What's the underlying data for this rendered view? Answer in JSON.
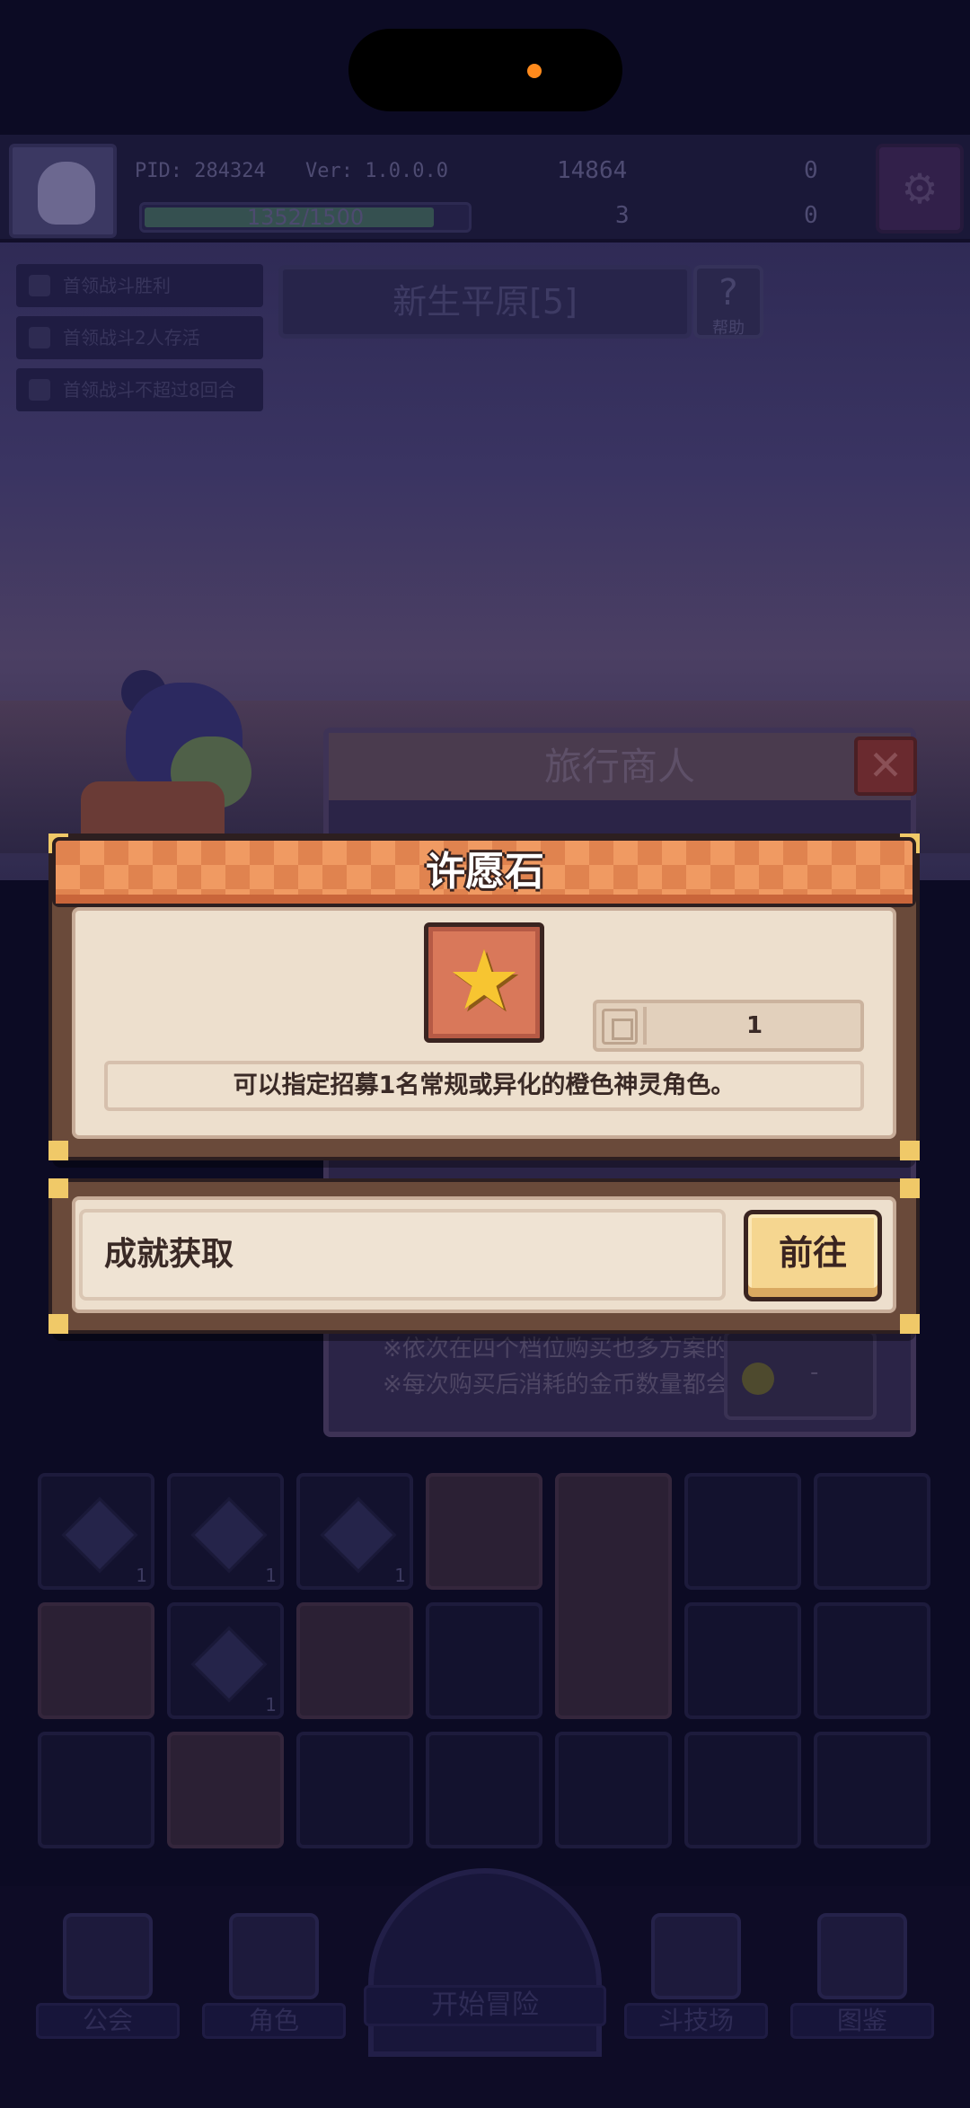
{
  "header": {
    "pid": "PID: 284324",
    "version": "Ver: 1.0.0.0",
    "gold": "14864",
    "gem": "0",
    "clover": "3",
    "key": "0",
    "energy_text": "1352/1500",
    "energy_fraction": 0.9
  },
  "quests": [
    "首领战斗胜利",
    "首领战斗2人存活",
    "首领战斗不超过8回合"
  ],
  "stage": {
    "title": "新生平原[5]",
    "help_label": "帮助"
  },
  "merchant": {
    "title": "旅行商人",
    "close_glyph": "✕",
    "notes": [
      "※依次在四个档位购买也多方案的奖励内容",
      "※每次购买后消耗的金币数量都会提升"
    ],
    "coin_value": "-"
  },
  "grid": {
    "counts": [
      "1",
      "1",
      "1",
      "1"
    ]
  },
  "nav": {
    "guild": "公会",
    "character": "角色",
    "start": "开始冒险",
    "arena": "斗技场",
    "codex": "图鉴"
  },
  "modal": {
    "title": "许愿石",
    "item_icon": "star-icon",
    "quantity": "1",
    "description": "可以指定招募1名常规或异化的橙色神灵角色。",
    "source_label": "成就获取",
    "go_label": "前往"
  },
  "colors": {
    "banner": "#e0834f",
    "panel": "#eddfcd",
    "frame": "#6a4a3a",
    "button": "#f5d690",
    "star": "#f7c531"
  }
}
